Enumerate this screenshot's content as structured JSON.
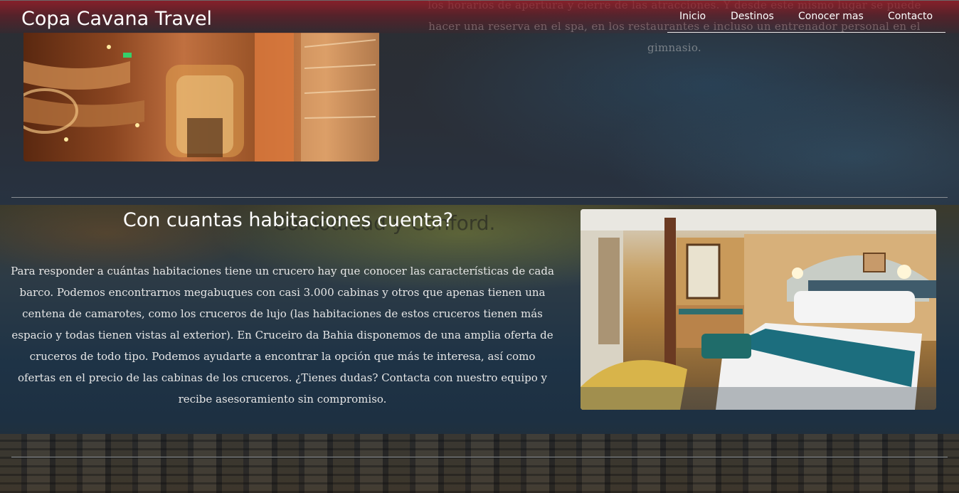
{
  "header": {
    "brand": "Copa Cavana Travel",
    "nav": [
      "Inicio",
      "Destinos",
      "Conocer mas",
      "Contacto"
    ]
  },
  "background_text": {
    "paragraph": "los horarios de apertura y cierre de las atracciones. Y desde este mismo lugar se puede hacer una reserva en el spa, en los restaurantes e incluso un entrenador personal en el gimnasio.",
    "title": "Comodidad y Conford."
  },
  "section": {
    "title": "Con cuantas habitaciones cuenta?",
    "body": "Para responder a cuántas habitaciones tiene un crucero hay que conocer las características de cada barco. Podemos encontrarnos megabuques con casi 3.000 cabinas y otros que apenas tienen una centena de camarotes, como los cruceros de lujo (las habitaciones de estos cruceros tienen más espacio y todas tienen vistas al exterior). En Cruceiro da Bahia disponemos de una amplia oferta de cruceros de todo tipo. Podemos ayudarte a encontrar la opción que más te interesa, así como ofertas en el precio de las cabinas de los cruceros. ¿Tienes dudas? Contacta con nuestro equipo y recibe asesoramiento sin compromiso."
  },
  "colors": {
    "header_accent": "#9e1e2a",
    "text": "#ffffff"
  }
}
